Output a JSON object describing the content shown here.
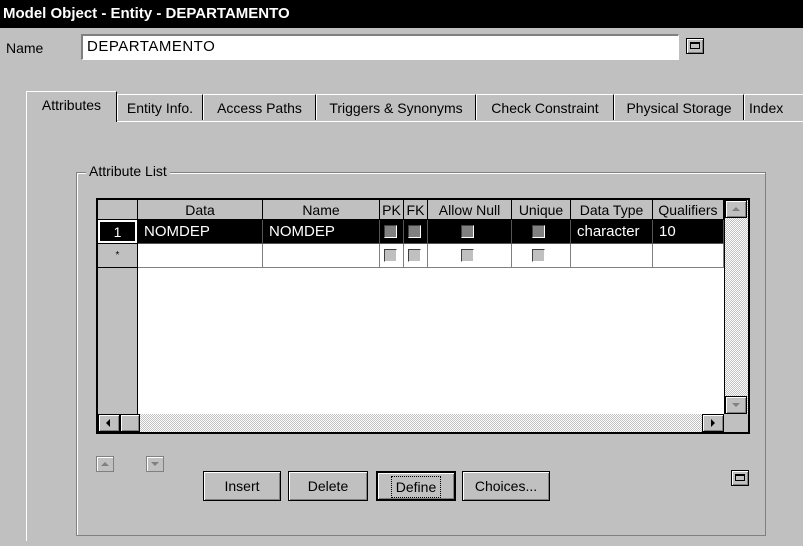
{
  "window": {
    "title": "Model Object - Entity - DEPARTAMENTO"
  },
  "name_row": {
    "label": "Name",
    "value": "DEPARTAMENTO"
  },
  "tabs": [
    {
      "label": "Attributes"
    },
    {
      "label": "Entity Info."
    },
    {
      "label": "Access Paths"
    },
    {
      "label": "Triggers & Synonyms"
    },
    {
      "label": "Check Constraint"
    },
    {
      "label": "Physical Storage"
    },
    {
      "label": "Index"
    }
  ],
  "attribute_list": {
    "label": "Attribute List",
    "columns": [
      "Data",
      "Name",
      "PK",
      "FK",
      "Allow Null",
      "Unique",
      "Data Type",
      "Qualifiers"
    ],
    "rows": [
      {
        "row_header": "1",
        "data": "NOMDEP",
        "name": "NOMDEP",
        "data_type": "character",
        "qualifiers": "10"
      },
      {
        "row_header": "*",
        "data": "",
        "name": "",
        "data_type": "",
        "qualifiers": ""
      }
    ]
  },
  "buttons": {
    "insert": "Insert",
    "delete": "Delete",
    "define": "Define",
    "choices": "Choices..."
  },
  "icons": [
    "expand-icon",
    "move-up-icon",
    "move-down-icon",
    "scroll-up-icon",
    "scroll-down-icon",
    "scroll-left-icon",
    "scroll-right-icon"
  ]
}
